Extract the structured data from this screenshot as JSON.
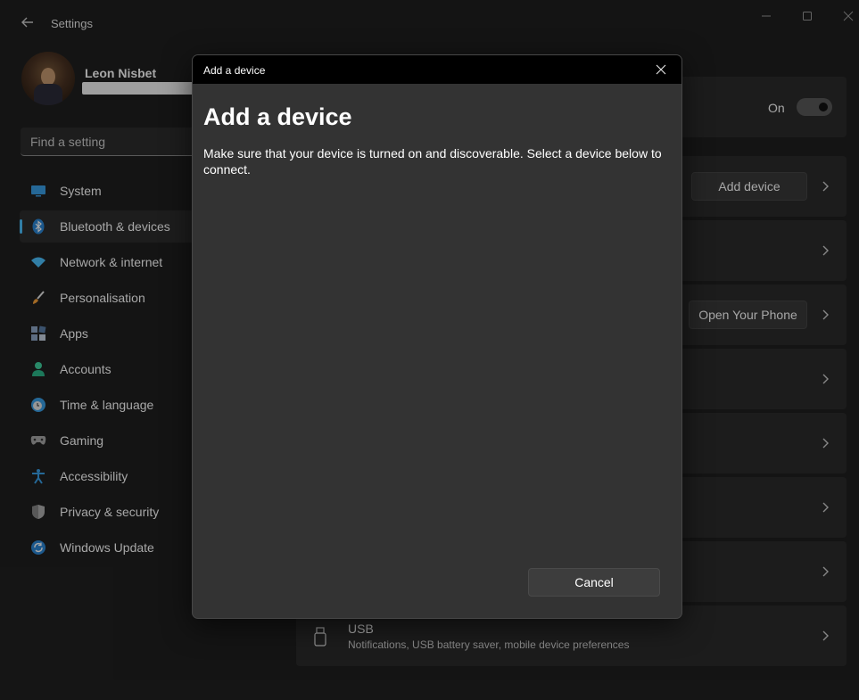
{
  "window": {
    "title": "Settings",
    "back_icon": "back-arrow-icon",
    "minimize_icon": "minimize-icon",
    "maximize_icon": "maximize-icon",
    "close_icon": "close-icon"
  },
  "profile": {
    "name": "Leon Nisbet"
  },
  "search": {
    "placeholder": "Find a setting"
  },
  "sidebar": {
    "items": [
      {
        "label": "System",
        "icon": "monitor-icon",
        "active": false
      },
      {
        "label": "Bluetooth & devices",
        "icon": "bluetooth-icon",
        "active": true
      },
      {
        "label": "Network & internet",
        "icon": "wifi-icon",
        "active": false
      },
      {
        "label": "Personalisation",
        "icon": "paintbrush-icon",
        "active": false
      },
      {
        "label": "Apps",
        "icon": "apps-icon",
        "active": false
      },
      {
        "label": "Accounts",
        "icon": "person-icon",
        "active": false
      },
      {
        "label": "Time & language",
        "icon": "globe-clock-icon",
        "active": false
      },
      {
        "label": "Gaming",
        "icon": "gamepad-icon",
        "active": false
      },
      {
        "label": "Accessibility",
        "icon": "accessibility-icon",
        "active": false
      },
      {
        "label": "Privacy & security",
        "icon": "shield-icon",
        "active": false
      },
      {
        "label": "Windows Update",
        "icon": "update-icon",
        "active": false
      }
    ]
  },
  "content": {
    "bluetooth_toggle_label": "On",
    "add_device_button": "Add device",
    "open_phone_button": "Open Your Phone",
    "usb": {
      "title": "USB",
      "subtitle": "Notifications, USB battery saver, mobile device preferences"
    }
  },
  "dialog": {
    "titlebar": "Add a device",
    "heading": "Add a device",
    "description": "Make sure that your device is turned on and discoverable. Select a device below to connect.",
    "cancel_button": "Cancel"
  },
  "colors": {
    "background": "#202020",
    "card": "#2b2b2b",
    "accent": "#4cc2ff",
    "dialog_bg": "#333333"
  }
}
